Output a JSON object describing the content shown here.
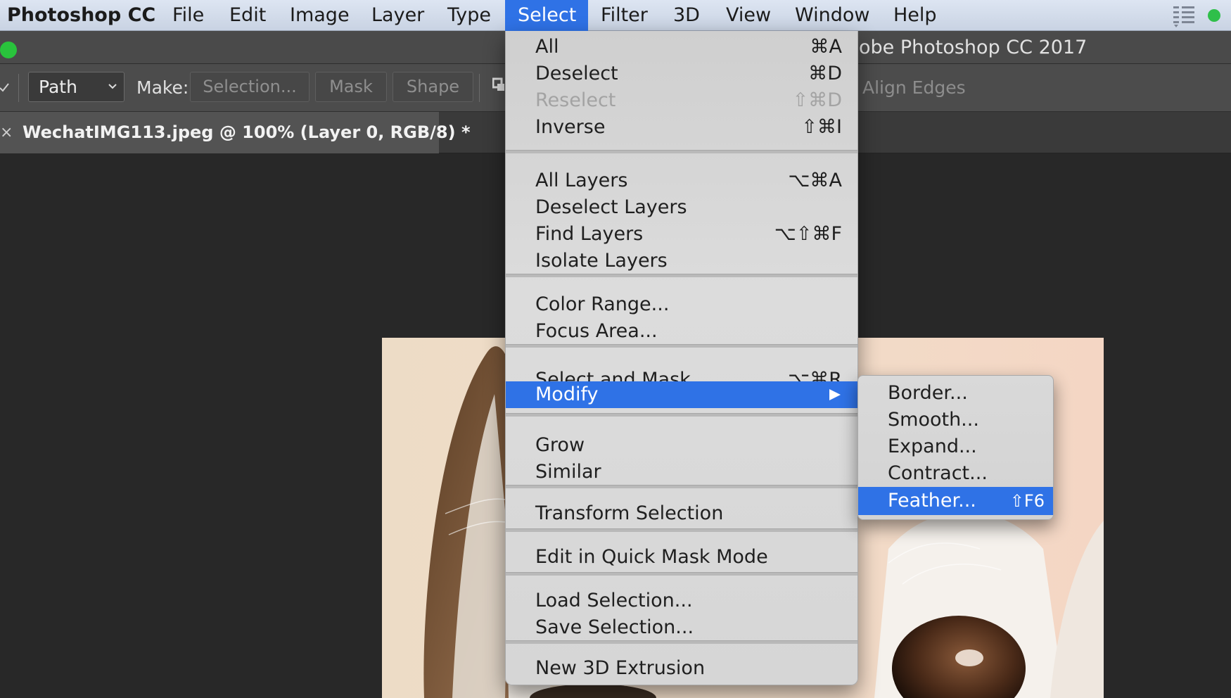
{
  "menubar": {
    "app_name": "Photoshop CC",
    "items": [
      "File",
      "Edit",
      "Image",
      "Layer",
      "Type",
      "Select",
      "Filter",
      "3D",
      "View",
      "Window",
      "Help"
    ],
    "active_item": "Select"
  },
  "window": {
    "title_visible_fragment": "obe Photoshop CC 2017"
  },
  "options_bar": {
    "mode_select_value": "Path",
    "make_label": "Make:",
    "buttons": [
      "Selection...",
      "Mask",
      "Shape"
    ],
    "align_edges_label": "Align Edges"
  },
  "document_tab": {
    "close_glyph": "×",
    "name": "WechatIMG113.jpeg @ 100% (Layer 0, RGB/8) *"
  },
  "select_menu": {
    "items": [
      {
        "label": "All",
        "shortcut": "⌘A",
        "enabled": true
      },
      {
        "label": "Deselect",
        "shortcut": "⌘D",
        "enabled": true
      },
      {
        "label": "Reselect",
        "shortcut": "⇧⌘D",
        "enabled": false
      },
      {
        "label": "Inverse",
        "shortcut": "⇧⌘I",
        "enabled": true
      },
      {
        "label": "All Layers",
        "shortcut": "⌥⌘A",
        "enabled": true
      },
      {
        "label": "Deselect Layers",
        "shortcut": "",
        "enabled": true
      },
      {
        "label": "Find Layers",
        "shortcut": "⌥⇧⌘F",
        "enabled": true
      },
      {
        "label": "Isolate Layers",
        "shortcut": "",
        "enabled": true
      },
      {
        "label": "Color Range...",
        "shortcut": "",
        "enabled": true
      },
      {
        "label": "Focus Area...",
        "shortcut": "",
        "enabled": true
      },
      {
        "label": "Select and Mask...",
        "shortcut": "⌥⌘R",
        "enabled": true
      },
      {
        "label": "Modify",
        "shortcut": "",
        "enabled": true,
        "submenu": true,
        "highlighted": true
      },
      {
        "label": "Grow",
        "shortcut": "",
        "enabled": true
      },
      {
        "label": "Similar",
        "shortcut": "",
        "enabled": true
      },
      {
        "label": "Transform Selection",
        "shortcut": "",
        "enabled": true
      },
      {
        "label": "Edit in Quick Mask Mode",
        "shortcut": "",
        "enabled": true
      },
      {
        "label": "Load Selection...",
        "shortcut": "",
        "enabled": true
      },
      {
        "label": "Save Selection...",
        "shortcut": "",
        "enabled": true
      },
      {
        "label": "New 3D Extrusion",
        "shortcut": "",
        "enabled": true
      }
    ]
  },
  "modify_submenu": {
    "items": [
      {
        "label": "Border...",
        "shortcut": ""
      },
      {
        "label": "Smooth...",
        "shortcut": ""
      },
      {
        "label": "Expand...",
        "shortcut": ""
      },
      {
        "label": "Contract...",
        "shortcut": ""
      },
      {
        "label": "Feather...",
        "shortcut": "⇧F6",
        "highlighted": true
      }
    ]
  },
  "colors": {
    "highlight": "#2f72e6",
    "menubar": "#d4dcea",
    "workspace": "#282828",
    "traffic_green": "#29c33c"
  },
  "icons": {
    "menubar_right": [
      "list-menu-icon",
      "status-dot-icon"
    ],
    "options_bar": [
      "checkmark-icon",
      "chevron-down-icon",
      "path-operations-icon"
    ]
  }
}
